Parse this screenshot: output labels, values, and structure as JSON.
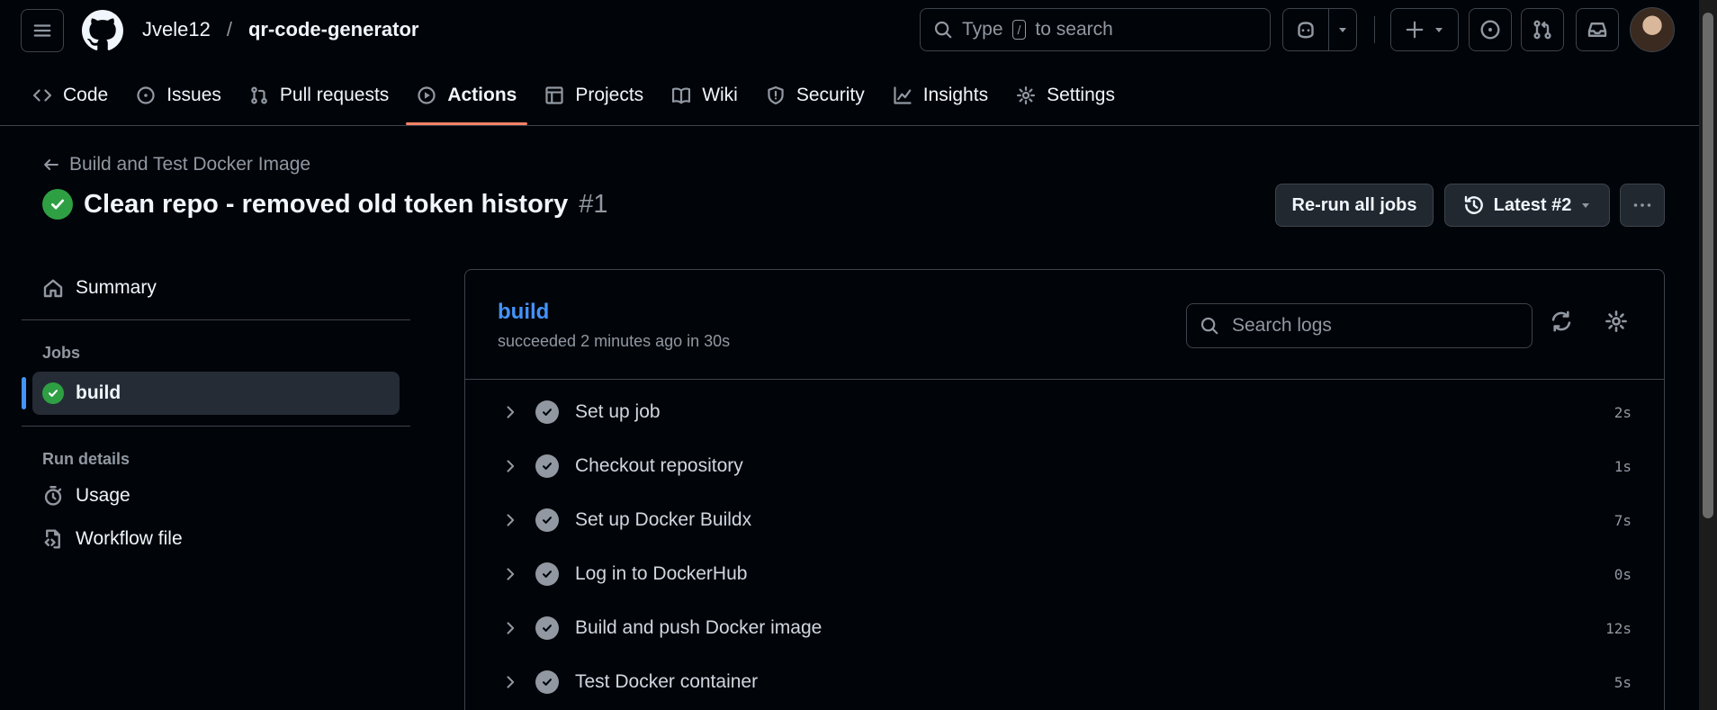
{
  "header": {
    "owner": "Jvele12",
    "separator": "/",
    "repo": "qr-code-generator",
    "search": {
      "prefix": "Type",
      "key": "/",
      "suffix": "to search"
    }
  },
  "tabs": [
    {
      "label": "Code",
      "icon": "code-icon"
    },
    {
      "label": "Issues",
      "icon": "issue-opened-icon"
    },
    {
      "label": "Pull requests",
      "icon": "git-pull-request-icon"
    },
    {
      "label": "Actions",
      "icon": "play-icon",
      "active": true
    },
    {
      "label": "Projects",
      "icon": "table-icon"
    },
    {
      "label": "Wiki",
      "icon": "book-icon"
    },
    {
      "label": "Security",
      "icon": "shield-icon"
    },
    {
      "label": "Insights",
      "icon": "graph-icon"
    },
    {
      "label": "Settings",
      "icon": "gear-icon"
    }
  ],
  "run": {
    "workflow": "Build and Test Docker Image",
    "title": "Clean repo - removed old token history",
    "number": "#1",
    "rerun_label": "Re-run all jobs",
    "attempt_label": "Latest #2"
  },
  "sidebar": {
    "summary": "Summary",
    "jobs_heading": "Jobs",
    "job": "build",
    "run_details_heading": "Run details",
    "usage": "Usage",
    "workflow_file": "Workflow file"
  },
  "job": {
    "name": "build",
    "status": "succeeded 2 minutes ago in 30s",
    "search_placeholder": "Search logs",
    "steps": [
      {
        "name": "Set up job",
        "duration": "2s"
      },
      {
        "name": "Checkout repository",
        "duration": "1s"
      },
      {
        "name": "Set up Docker Buildx",
        "duration": "7s"
      },
      {
        "name": "Log in to DockerHub",
        "duration": "0s"
      },
      {
        "name": "Build and push Docker image",
        "duration": "12s"
      },
      {
        "name": "Test Docker container",
        "duration": "5s"
      }
    ]
  },
  "colors": {
    "background": "#010409",
    "accent_tab_underline": "#f78166",
    "success": "#2ea043",
    "link": "#4493f8"
  }
}
